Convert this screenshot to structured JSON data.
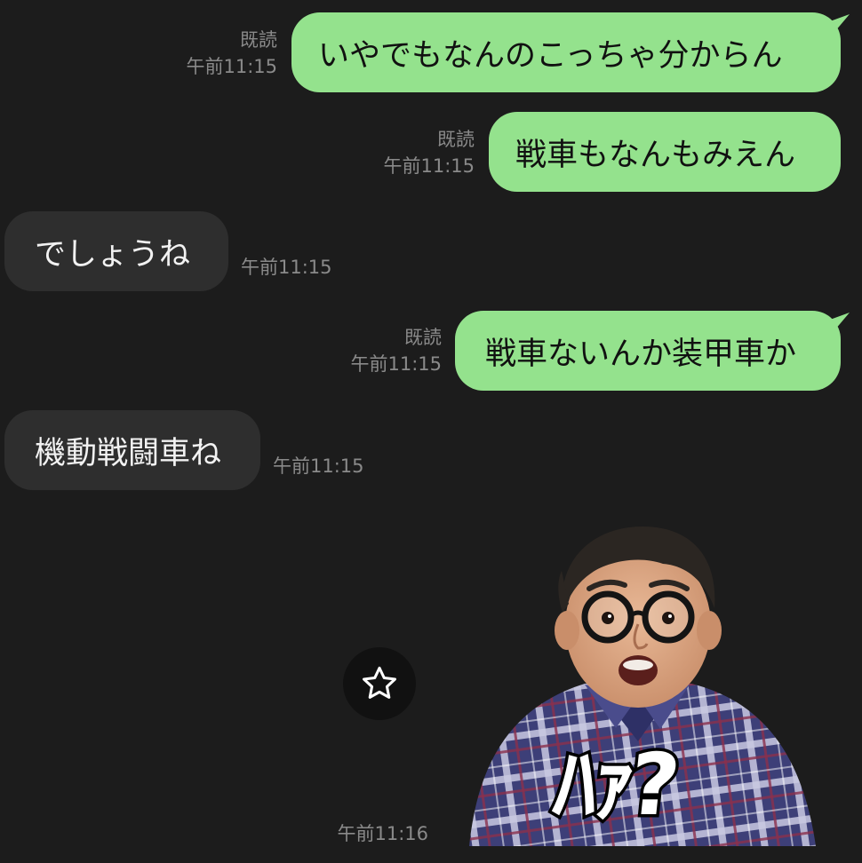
{
  "messages": [
    {
      "side": "out",
      "text": "いやでもなんのこっちゃ分からん",
      "read": "既読",
      "time": "午前11:15"
    },
    {
      "side": "out",
      "text": "戦車もなんもみえん",
      "read": "既読",
      "time": "午前11:15"
    },
    {
      "side": "in",
      "text": "でしょうね",
      "time": "午前11:15"
    },
    {
      "side": "out",
      "text": "戦車ないんか装甲車か",
      "read": "既読",
      "time": "午前11:15"
    },
    {
      "side": "in",
      "text": "機動戦闘車ね",
      "time": "午前11:15"
    }
  ],
  "sticker": {
    "time": "午前11:16",
    "caption": "ﾊｧ?",
    "star_icon": "star-icon"
  },
  "colors": {
    "background": "#1c1c1c",
    "outgoing_bubble": "#94e28d",
    "incoming_bubble": "#2e2e2e",
    "meta_text": "#8a8a8a"
  }
}
